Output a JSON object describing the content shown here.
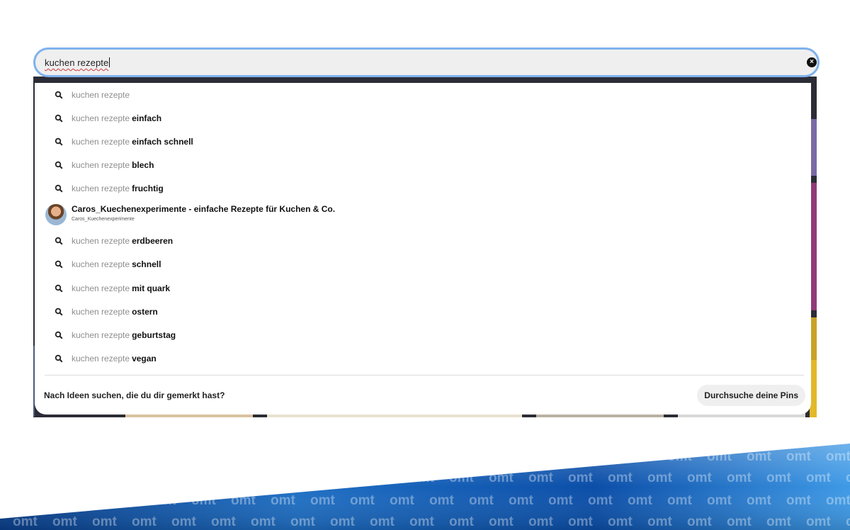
{
  "search": {
    "query_word1": "kuchen",
    "query_word2": "rezepte",
    "clear_icon": "close-circle-icon"
  },
  "suggestions": [
    {
      "prefix": "kuchen rezepte",
      "suffix": ""
    },
    {
      "prefix": "kuchen rezepte",
      "suffix": "einfach"
    },
    {
      "prefix": "kuchen rezepte",
      "suffix": "einfach schnell"
    },
    {
      "prefix": "kuchen rezepte",
      "suffix": "blech"
    },
    {
      "prefix": "kuchen rezepte",
      "suffix": "fruchtig"
    }
  ],
  "profile": {
    "title": "Caros_Kuechenexperimente - einfache Rezepte für Kuchen & Co.",
    "username": "Caros_Kuechenexperimente"
  },
  "suggestions2": [
    {
      "prefix": "kuchen rezepte",
      "suffix": "erdbeeren"
    },
    {
      "prefix": "kuchen rezepte",
      "suffix": "schnell"
    },
    {
      "prefix": "kuchen rezepte",
      "suffix": "mit quark"
    },
    {
      "prefix": "kuchen rezepte",
      "suffix": "ostern"
    },
    {
      "prefix": "kuchen rezepte",
      "suffix": "geburtstag"
    },
    {
      "prefix": "kuchen rezepte",
      "suffix": "vegan"
    }
  ],
  "footer": {
    "prompt": "Nach Ideen suchen, die du dir gemerkt hast?",
    "button_label": "Durchsuche deine Pins"
  },
  "banner": {
    "logo_text": "omt",
    "colors": {
      "dark": "#0a3f8c",
      "mid": "#1f6fc4",
      "light": "#3f9ae6"
    }
  }
}
